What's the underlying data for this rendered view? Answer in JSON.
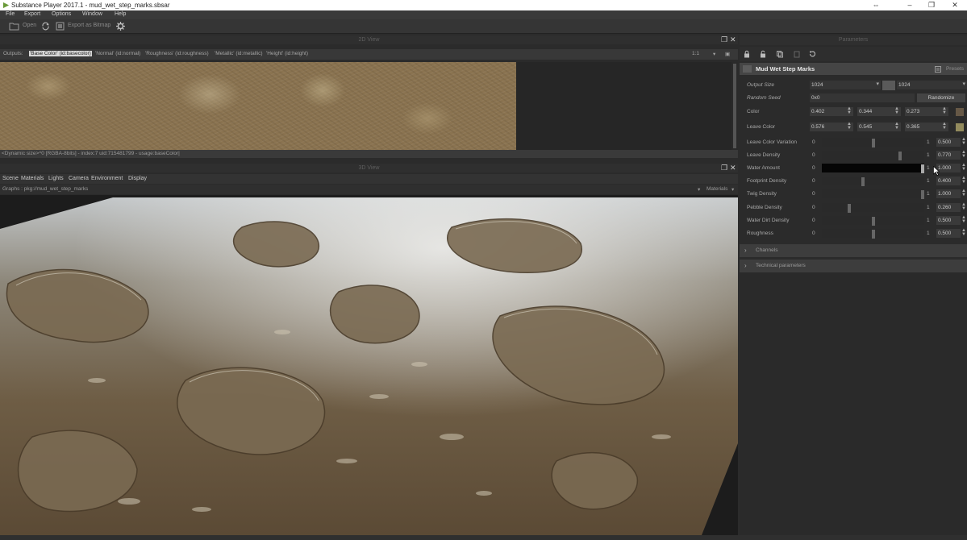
{
  "titlebar": {
    "title": "Substance Player 2017.1 - mud_wet_step_marks.sbsar",
    "controls": [
      "⇔",
      "–",
      "❐",
      "✕"
    ]
  },
  "menu": [
    "File",
    "Export",
    "Options",
    "Window",
    "Help"
  ],
  "toolbar": {
    "open": "Open",
    "export": "Export as Bitmap"
  },
  "view2d": {
    "header": "2D View",
    "outputs_label": "Outputs:",
    "outputs": [
      "'Base Color' (id:basecolor)",
      "'Normal' (id:normal)",
      "'Roughness' (id:roughness)",
      "'Metallic' (id:metallic)",
      "'Height' (id:height)"
    ],
    "zoom": "1:1",
    "status": "<Dynamic size>^0 [RGBA-8bits] - index:7 uid:715481799 - usage:baseColor|"
  },
  "view3d": {
    "header": "3D View",
    "menu": [
      "Scene",
      "Materials",
      "Lights",
      "Camera",
      "Environment",
      "Display"
    ],
    "graph_label": "Graphs : pkg://mud_wet_step_marks",
    "materials_label": "Materials"
  },
  "params": {
    "header": "Parameters",
    "graph_name": "Mud Wet Step Marks",
    "presets": "Presets",
    "output_size_label": "Output Size",
    "output_size_w": "1024",
    "output_size_h": "1024",
    "random_seed_label": "Random Seed",
    "random_seed_value": "0x0",
    "randomize": "Randomize",
    "color_label": "Color",
    "color_values": [
      "0.402",
      "0.344",
      "0.273"
    ],
    "color_swatch": "#665846",
    "leave_color_label": "Leave Color",
    "leave_color_values": [
      "0.576",
      "0.545",
      "0.365"
    ],
    "leave_color_swatch": "#938b5d",
    "sliders": [
      {
        "label": "Leave Color Variation",
        "min": "0",
        "max": "1",
        "value": "0.500",
        "position": 0.5,
        "black": false
      },
      {
        "label": "Leave Density",
        "min": "0",
        "max": "1",
        "value": "0.770",
        "position": 0.77,
        "black": false
      },
      {
        "label": "Water Amount",
        "min": "0",
        "max": "1",
        "value": "1.000",
        "position": 1.0,
        "black": true
      },
      {
        "label": "Footprint Density",
        "min": "0",
        "max": "1",
        "value": "0.400",
        "position": 0.4,
        "black": false
      },
      {
        "label": "Twig Density",
        "min": "0",
        "max": "1",
        "value": "1.000",
        "position": 1.0,
        "black": false
      },
      {
        "label": "Pebble Density",
        "min": "0",
        "max": "1",
        "value": "0.260",
        "position": 0.26,
        "black": false
      },
      {
        "label": "Water Dirt Density",
        "min": "0",
        "max": "1",
        "value": "0.500",
        "position": 0.5,
        "black": false
      },
      {
        "label": "Roughness",
        "min": "0",
        "max": "1",
        "value": "0.500",
        "position": 0.5,
        "black": false
      }
    ],
    "sections": [
      "Channels",
      "Technical parameters"
    ]
  }
}
